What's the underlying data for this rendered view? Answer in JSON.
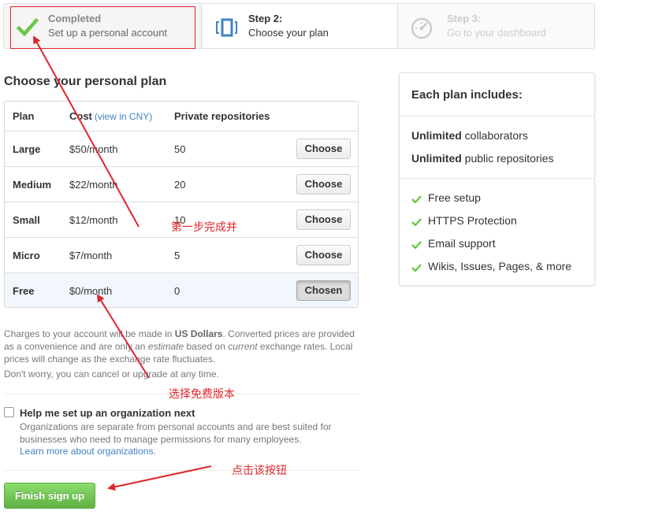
{
  "steps": [
    {
      "title": "Completed",
      "desc": "Set up a personal account",
      "icon": "checkmark-icon",
      "state": "done"
    },
    {
      "title": "Step 2:",
      "desc": "Choose your plan",
      "icon": "plan-icon",
      "state": "current"
    },
    {
      "title": "Step 3:",
      "desc": "Go to your dashboard",
      "icon": "dashboard-icon",
      "state": "upcoming"
    }
  ],
  "plan_section": {
    "heading": "Choose your personal plan",
    "columns": {
      "plan": "Plan",
      "cost": "Cost",
      "cost_link": "(view in CNY)",
      "repos": "Private repositories"
    },
    "rows": [
      {
        "plan": "Large",
        "cost": "$50/month",
        "repos": "50",
        "button": "Choose"
      },
      {
        "plan": "Medium",
        "cost": "$22/month",
        "repos": "20",
        "button": "Choose"
      },
      {
        "plan": "Small",
        "cost": "$12/month",
        "repos": "10",
        "button": "Choose"
      },
      {
        "plan": "Micro",
        "cost": "$7/month",
        "repos": "5",
        "button": "Choose"
      },
      {
        "plan": "Free",
        "cost": "$0/month",
        "repos": "0",
        "button": "Chosen"
      }
    ],
    "selected_plan": "Free"
  },
  "notes": {
    "p1_a": "Charges to your account will be made in ",
    "p1_b": "US Dollars",
    "p1_c": ". Converted prices are provided as a convenience and are only an ",
    "p1_d": "estimate",
    "p1_e": " based on ",
    "p1_f": "current",
    "p1_g": " exchange rates. Local prices will change as the exchange rate fluctuates.",
    "p2": "Don't worry, you can cancel or upgrade at any time."
  },
  "organization": {
    "checked": false,
    "title": "Help me set up an organization next",
    "desc": "Organizations are separate from personal accounts and are best suited for businesses who need to manage permissions for many employees.",
    "link": "Learn more about organizations."
  },
  "finish_button": "Finish sign up",
  "includes": {
    "title": "Each plan includes:",
    "unlimited_word": "Unlimited",
    "unlimited": [
      " collaborators",
      " public repositories"
    ],
    "features": [
      "Free setup",
      "HTTPS Protection",
      "Email support",
      "Wikis, Issues, Pages, & more"
    ]
  },
  "annotations": {
    "a1": "第一步完成并",
    "a2": "选择免费版本",
    "a3": "点击该按钮"
  },
  "colors": {
    "accent_red": "#e0252b",
    "check_green": "#6cc644",
    "link_blue": "#4183c4",
    "button_green": "#60b044",
    "plan_icon_blue": "#4183c4"
  }
}
